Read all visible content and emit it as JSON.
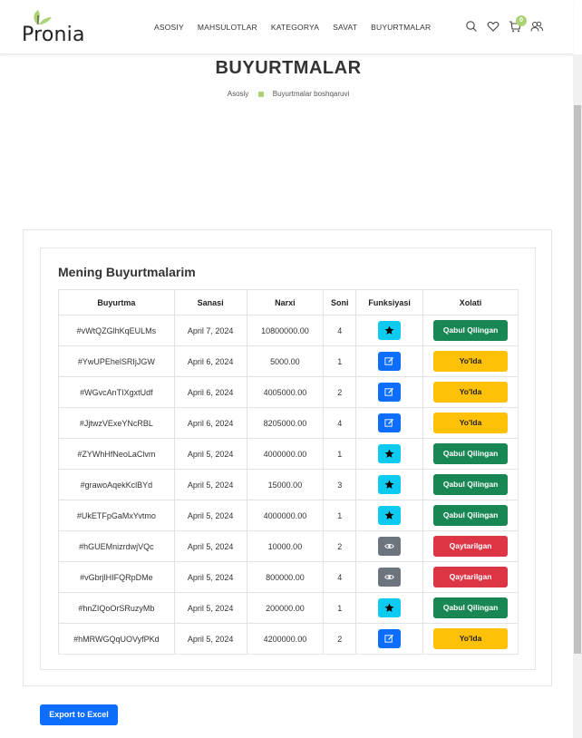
{
  "logo": {
    "text": "Pronia"
  },
  "nav": {
    "items": [
      "ASOSIY",
      "MAHSULOTLAR",
      "KATEGORYA",
      "SAVAT",
      "BUYURTMALAR"
    ]
  },
  "header_icons": {
    "search": "search-icon",
    "wishlist": "heart-icon",
    "cart": "cart-icon",
    "cart_count": "0",
    "user": "users-icon"
  },
  "breadcrumb": {
    "title": "BUYURTMALAR",
    "home": "Asosiy",
    "current": "Buyurtmalar boshqaruvi"
  },
  "orders": {
    "title": "Mening Buyurtmalarim",
    "columns": [
      "Buyurtma",
      "Sanasi",
      "Narxi",
      "Soni",
      "Funksiyasi",
      "Xolati"
    ],
    "rows": [
      {
        "id": "#vWtQZGlhKqEULMs",
        "date": "April 7, 2024",
        "price": "10800000.00",
        "qty": "4",
        "action": "star",
        "status": "Qabul Qilingan",
        "status_type": "green"
      },
      {
        "id": "#YwUPEhelSRIjJGW",
        "date": "April 6, 2024",
        "price": "5000.00",
        "qty": "1",
        "action": "edit",
        "status": "Yo'lda",
        "status_type": "yellow"
      },
      {
        "id": "#WGvcAnTIXgxtUdf",
        "date": "April 6, 2024",
        "price": "4005000.00",
        "qty": "2",
        "action": "edit",
        "status": "Yo'lda",
        "status_type": "yellow"
      },
      {
        "id": "#JjtwzVExeYNcRBL",
        "date": "April 6, 2024",
        "price": "8205000.00",
        "qty": "4",
        "action": "edit",
        "status": "Yo'lda",
        "status_type": "yellow"
      },
      {
        "id": "#ZYWhHfNeoLaClvm",
        "date": "April 5, 2024",
        "price": "4000000.00",
        "qty": "1",
        "action": "star",
        "status": "Qabul Qilingan",
        "status_type": "green"
      },
      {
        "id": "#grawoAqekKclBYd",
        "date": "April 5, 2024",
        "price": "15000.00",
        "qty": "3",
        "action": "star",
        "status": "Qabul Qilingan",
        "status_type": "green"
      },
      {
        "id": "#UkETFpGaMxYvtmo",
        "date": "April 5, 2024",
        "price": "4000000.00",
        "qty": "1",
        "action": "star",
        "status": "Qabul Qilingan",
        "status_type": "green"
      },
      {
        "id": "#hGUEMnizrdwjVQc",
        "date": "April 5, 2024",
        "price": "10000.00",
        "qty": "2",
        "action": "view",
        "status": "Qaytarilgan",
        "status_type": "red"
      },
      {
        "id": "#vGbrjlHIFQRpDMe",
        "date": "April 5, 2024",
        "price": "800000.00",
        "qty": "4",
        "action": "view",
        "status": "Qaytarilgan",
        "status_type": "red"
      },
      {
        "id": "#hnZIQoOrSRuzyMb",
        "date": "April 5, 2024",
        "price": "200000.00",
        "qty": "1",
        "action": "star",
        "status": "Qabul Qilingan",
        "status_type": "green"
      },
      {
        "id": "#hMRWGQqUOVyfPKd",
        "date": "April 5, 2024",
        "price": "4200000.00",
        "qty": "2",
        "action": "edit",
        "status": "Yo'lda",
        "status_type": "yellow"
      }
    ]
  },
  "export": {
    "label": "Export to Excel"
  },
  "colors": {
    "accent": "#abd373",
    "status_green": "#198754",
    "status_yellow": "#ffc107",
    "status_red": "#dc3545",
    "btn_info": "#0dcaf0",
    "btn_primary": "#0d6efd",
    "btn_secondary": "#6c757d"
  }
}
